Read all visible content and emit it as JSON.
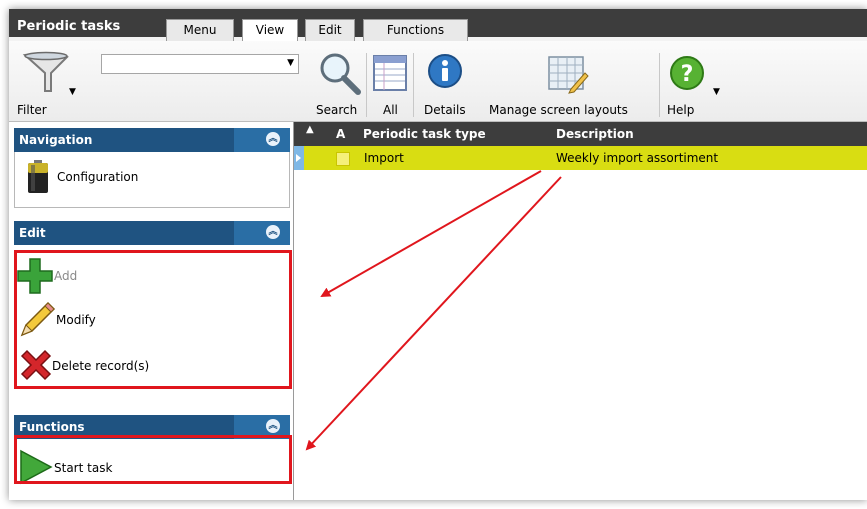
{
  "app": {
    "title": "Periodic tasks"
  },
  "tabs": [
    {
      "label": "Menu",
      "active": false
    },
    {
      "label": "View",
      "active": true
    },
    {
      "label": "Edit",
      "active": false
    },
    {
      "label": "Functions",
      "active": false
    }
  ],
  "ribbon": {
    "filter_label": "Filter",
    "filter_value": "",
    "search_label": "Search",
    "all_label": "All",
    "details_label": "Details",
    "layouts_label": "Manage screen layouts",
    "help_label": "Help"
  },
  "panels": {
    "navigation": {
      "title": "Navigation",
      "items": [
        {
          "label": "Configuration",
          "icon": "battery-icon"
        }
      ]
    },
    "edit": {
      "title": "Edit",
      "items": [
        {
          "label": "Add",
          "icon": "plus-icon",
          "enabled": false
        },
        {
          "label": "Modify",
          "icon": "pencil-icon",
          "enabled": true
        },
        {
          "label": "Delete record(s)",
          "icon": "red-x-icon",
          "enabled": true
        }
      ]
    },
    "functions": {
      "title": "Functions",
      "items": [
        {
          "label": "Start task",
          "icon": "green-play-icon"
        }
      ]
    }
  },
  "grid": {
    "columns": [
      "A",
      "Periodic task type",
      "Description"
    ],
    "rows": [
      {
        "type": "Import",
        "description": "Weekly import assortiment",
        "selected": true
      }
    ]
  },
  "colors": {
    "header_dark": "#3d3d3d",
    "panel_header": "#1f5381",
    "highlight_row": "#d9dd12",
    "annotation_red": "#e0161d"
  }
}
